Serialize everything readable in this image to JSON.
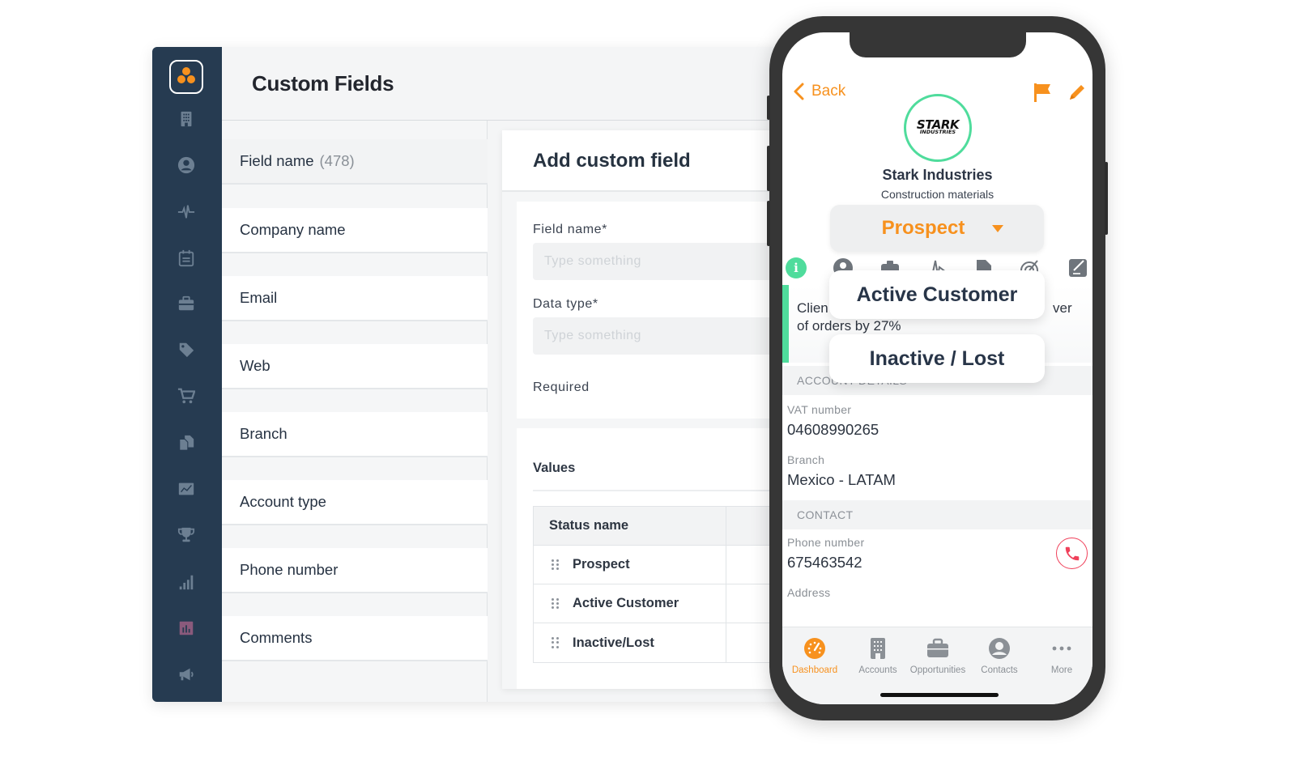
{
  "app": {
    "page_title": "Custom Fields",
    "sidebar": {
      "items": [
        {
          "name": "accounts",
          "icon": "building-icon"
        },
        {
          "name": "contacts",
          "icon": "user-circle-icon"
        },
        {
          "name": "activity",
          "icon": "pulse-icon"
        },
        {
          "name": "calendar",
          "icon": "calendar-icon"
        },
        {
          "name": "opportunities",
          "icon": "briefcase-icon"
        },
        {
          "name": "tags",
          "icon": "tag-icon"
        },
        {
          "name": "orders",
          "icon": "cart-icon"
        },
        {
          "name": "documents",
          "icon": "documents-icon"
        },
        {
          "name": "analytics",
          "icon": "line-chart-icon"
        },
        {
          "name": "goals",
          "icon": "trophy-icon"
        },
        {
          "name": "reports",
          "icon": "bar-chart-icon"
        },
        {
          "name": "dashboards",
          "icon": "report-chart-icon"
        },
        {
          "name": "campaigns",
          "icon": "megaphone-icon"
        }
      ]
    },
    "field_list": {
      "header_label": "Field name",
      "header_count": "(478)",
      "fields": [
        "Company name",
        "Email",
        "Web",
        "Branch",
        "Account type",
        "Phone number",
        "Comments"
      ]
    },
    "add_panel": {
      "title": "Add custom field",
      "field_name_label": "Field name*",
      "field_name_placeholder": "Type something",
      "data_type_label": "Data type*",
      "data_type_placeholder": "Type something",
      "required_label": "Required",
      "values_label": "Values",
      "table_header": "Status name",
      "statuses": [
        "Prospect",
        "Active Customer",
        "Inactive/Lost"
      ]
    }
  },
  "phone": {
    "back_label": "Back",
    "logo_text": "STARK",
    "logo_subtext": "INDUSTRIES",
    "company_name": "Stark Industries",
    "industry": "Construction materials",
    "status_selected": "Prospect",
    "status_options": [
      "Active Customer",
      "Inactive / Lost"
    ],
    "note_line1": "Clien",
    "note_line1_end": "ver",
    "note_line2": "of orders by 27%",
    "sections": {
      "account_details": "ACCOUNT DETAILS",
      "contact": "CONTACT"
    },
    "details": [
      {
        "label": "VAT number",
        "value": "04608990265"
      },
      {
        "label": "Branch",
        "value": "Mexico - LATAM"
      }
    ],
    "contact": {
      "phone_label": "Phone number",
      "phone_value": "675463542",
      "address_label": "Address"
    },
    "tabbar": [
      {
        "label": "Dashboard",
        "icon": "dashboard-icon",
        "active": true
      },
      {
        "label": "Accounts",
        "icon": "building-icon",
        "active": false
      },
      {
        "label": "Opportunities",
        "icon": "briefcase-icon",
        "active": false
      },
      {
        "label": "Contacts",
        "icon": "user-circle-icon",
        "active": false
      },
      {
        "label": "More",
        "icon": "more-dots-icon",
        "active": false
      }
    ]
  },
  "colors": {
    "brand_orange": "#f7911e",
    "sidebar_navy": "#263b51",
    "accent_green": "#4fdc9c",
    "call_red": "#f0405a"
  }
}
